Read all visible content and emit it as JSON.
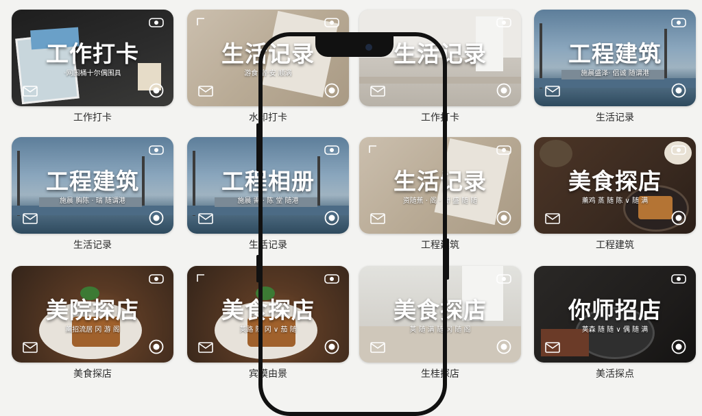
{
  "cards": [
    {
      "title": "工作打卡",
      "subtitle": "·网围桶十尔偶围具",
      "label": "工作打卡",
      "theme": "office"
    },
    {
      "title": "生活记录",
      "subtitle": "游食·宿·安 顺涡",
      "label": "水印打卡",
      "theme": "paper"
    },
    {
      "title": "生活记录",
      "subtitle": "",
      "label": "工作打卡",
      "theme": "room"
    },
    {
      "title": "工程建筑",
      "subtitle": "施晨盛泽· 侣诚 随谓港",
      "label": "生活记录",
      "theme": "site"
    },
    {
      "title": "工程建筑",
      "subtitle": "施晨 胸陈 · 瑞 随谓港",
      "label": "生活记录",
      "theme": "site"
    },
    {
      "title": "工程相册",
      "subtitle": "施晨 需 · 陈 堂 随港",
      "label": "生活记录",
      "theme": "site"
    },
    {
      "title": "生活记录",
      "subtitle": "资随蕉 · 阁 · 姗 盛 随 随",
      "label": "工程建筑",
      "theme": "paper"
    },
    {
      "title": "美食探店",
      "subtitle": "薰鸡 蒸 随 陈 ∨ 随 满",
      "label": "工程建筑",
      "theme": "wood"
    },
    {
      "title": "美院探店",
      "subtitle": "薰招流居 冈 游 阁",
      "label": "美食探店",
      "theme": "food"
    },
    {
      "title": "美食探店",
      "subtitle": "荚路 随 冈 ∨ 茄 随",
      "label": "宾模由景",
      "theme": "food"
    },
    {
      "title": "美食探店",
      "subtitle": "荚 随 满 随 冈 随 阁",
      "label": "生桂探店",
      "theme": "kitchen"
    },
    {
      "title": "你师招店",
      "subtitle": "荚森 随 随 ∨ 偶 随 满",
      "label": "美活探点",
      "theme": "dark"
    }
  ],
  "icons": {
    "top": "camera-icon",
    "mail": "mail-icon",
    "bottom": "camera-aperture-icon",
    "corner": "corner-bracket-icon"
  }
}
